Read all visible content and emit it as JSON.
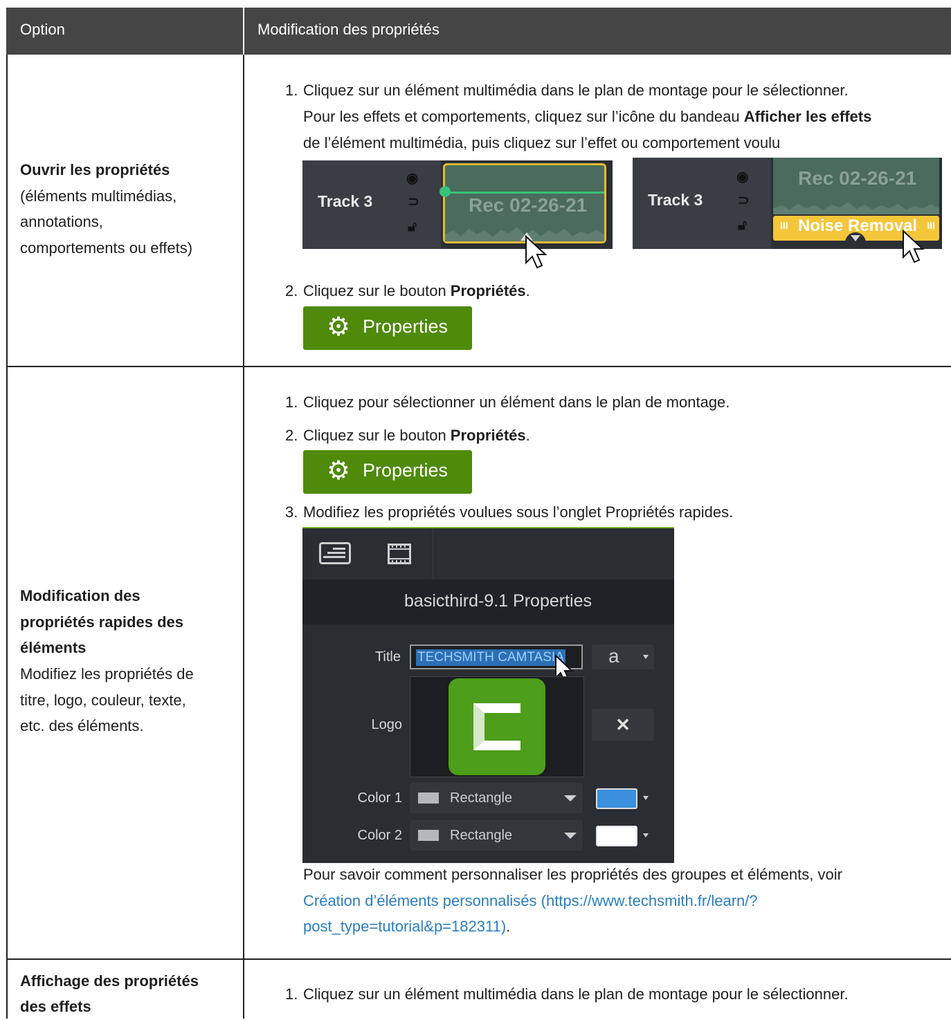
{
  "table": {
    "header": {
      "option": "Option",
      "modification": "Modification des propriétés"
    }
  },
  "row1": {
    "title": "Ouvrir les propriétés",
    "desc": [
      "(éléments multimédias,",
      "annotations,",
      "comportements ou effets)"
    ],
    "step1": {
      "num": "1.",
      "line1": "Cliquez sur un élément multimédia dans le plan de montage pour le sélectionner.",
      "line2_pre": "Pour les effets et comportements, cliquez sur l’icône du bandeau ",
      "line2_bold": "Afficher les effets",
      "line3": "de l’élément multimédia, puis cliquez sur l’effet ou comportement voulu"
    },
    "track_a": {
      "name": "Track 3",
      "clip_text": "Rec 02-26-21"
    },
    "track_b": {
      "name": "Track 3",
      "clip_text": "Rec 02-26-21",
      "effect": "Noise Removal"
    },
    "step2": {
      "num": "2.",
      "pre": "Cliquez sur le bouton ",
      "bold": "Propriétés",
      "post": "."
    },
    "button": "Properties"
  },
  "row2": {
    "title": [
      "Modification des",
      "propriétés rapides des",
      "éléments"
    ],
    "desc": [
      "Modifiez les propriétés de",
      "titre, logo, couleur, texte,",
      "etc. des éléments."
    ],
    "step1": {
      "num": "1.",
      "text": "Cliquez pour sélectionner un élément dans le plan de montage."
    },
    "step2": {
      "num": "2.",
      "pre": "Cliquez sur le bouton ",
      "bold": "Propriétés",
      "post": "."
    },
    "button": "Properties",
    "step3": {
      "num": "3.",
      "text": "Modifiez les propriétés voulues sous l’onglet Propriétés rapides."
    },
    "panel": {
      "title": "basicthird-9.1 Properties",
      "title_label": "Title",
      "title_value": "TECHSMITH CAMTASIA",
      "font_glyph": "a",
      "logo_label": "Logo",
      "color1_label": "Color 1",
      "color1_value": "Rectangle",
      "color1_swatch": "#3b8fdc",
      "color2_label": "Color 2",
      "color2_value": "Rectangle",
      "color2_swatch": "#ffffff",
      "accent": "#79b829"
    },
    "note": {
      "line1": "Pour savoir comment personnaliser les propriétés des groupes et éléments, voir",
      "link1": "Création d’éléments personnalisés (https://www.techsmith.fr/learn/?",
      "link2": "post_type=tutorial&p=182311)",
      "post": "."
    }
  },
  "row3": {
    "title": [
      "Affichage des propriétés",
      "des effets"
    ],
    "step1": {
      "num": "1.",
      "text": "Cliquez sur un élément multimédia dans le plan de montage pour le sélectionner."
    }
  }
}
